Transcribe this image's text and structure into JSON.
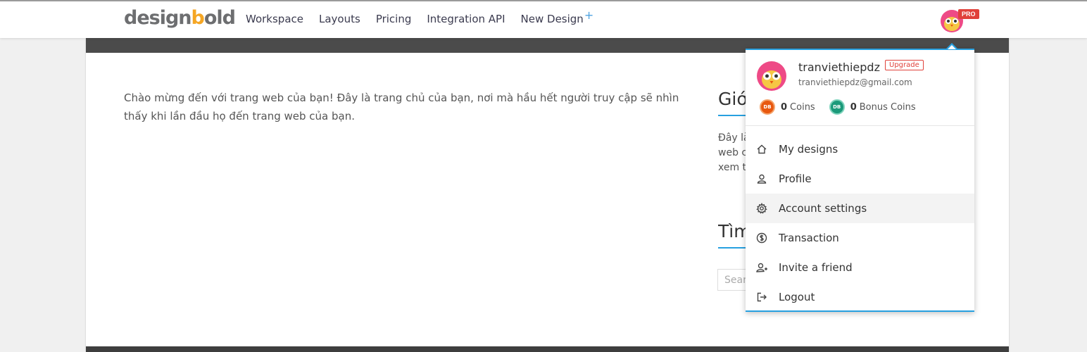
{
  "header": {
    "logo_text_a": "design",
    "logo_text_b": "b",
    "logo_text_c": "old",
    "nav": [
      "Workspace",
      "Layouts",
      "Pricing",
      "Integration API",
      "New Design"
    ],
    "new_design_plus": "+",
    "pro_badge": "PRO"
  },
  "main": {
    "welcome": "Chào mừng đến với trang web của bạn! Đây là trang chủ của bạn, nơi mà hầu hết người truy cập sẽ nhìn thấy khi lần đầu họ đến trang web của bạn.",
    "side_title": "Giới",
    "side_text_lines": [
      "Đây là",
      "web c",
      "xem t"
    ],
    "side_title2": "Tìm",
    "search_placeholder": "Search"
  },
  "dropdown": {
    "username": "tranviethiepdz",
    "upgrade_label": "Upgrade",
    "email": "tranviethiepdz@gmail.com",
    "coins_value": "0",
    "coins_label": "Coins",
    "bonus_value": "0",
    "bonus_label": "Bonus Coins",
    "coin_badge": "DB",
    "items": [
      {
        "label": "My designs",
        "icon": "home-icon"
      },
      {
        "label": "Profile",
        "icon": "user-icon"
      },
      {
        "label": "Account settings",
        "icon": "gear-icon"
      },
      {
        "label": "Transaction",
        "icon": "dollar-circle-icon"
      },
      {
        "label": "Invite a friend",
        "icon": "user-plus-icon"
      },
      {
        "label": "Logout",
        "icon": "logout-icon"
      }
    ]
  },
  "colors": {
    "accent": "#27a0e0",
    "badge_red": "#e0413a",
    "coin_orange": "#e8580f",
    "coin_green": "#1b9a7a"
  }
}
